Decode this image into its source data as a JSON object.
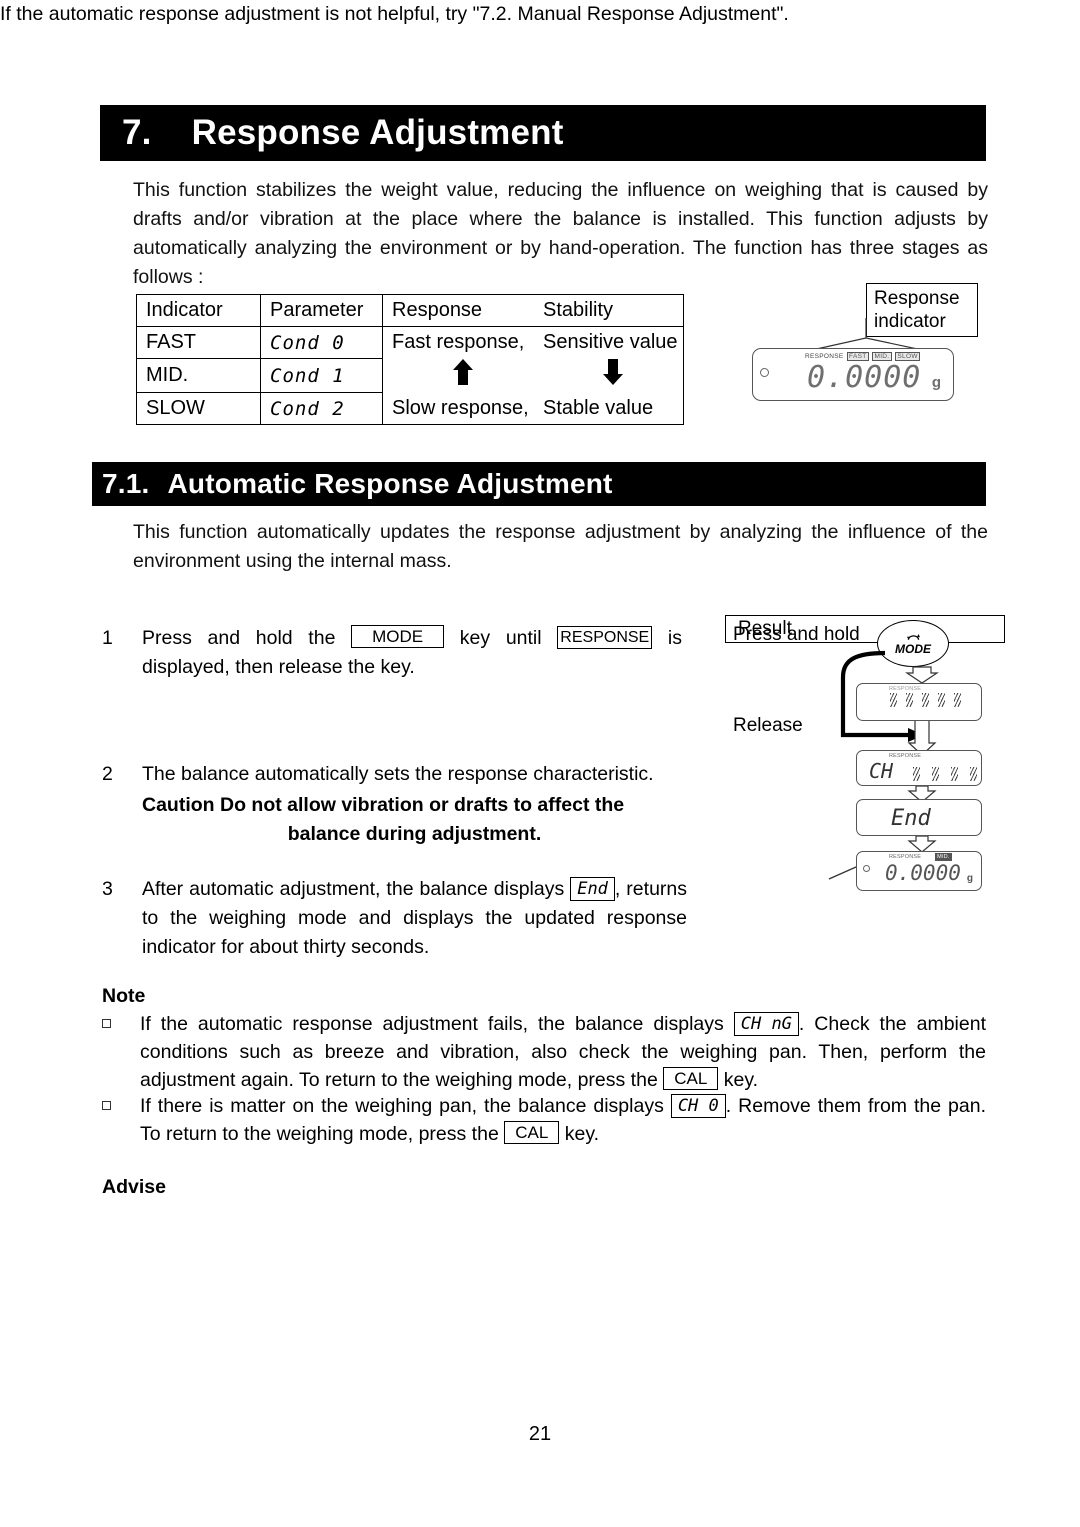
{
  "page": {
    "number": "21"
  },
  "heading": {
    "section_number": "7.",
    "section_title": "Response Adjustment",
    "sub_number": "7.1.",
    "sub_title": "Automatic Response Adjustment"
  },
  "intro": {
    "paragraph": "This function stabilizes the weight value, reducing the influence on weighing that is caused by drafts and/or vibration at the place where the balance is installed. This function adjusts by automatically analyzing the environment or by hand-operation. The function has three stages as follows :"
  },
  "table": {
    "headers": [
      "Indicator",
      "Parameter",
      "Response",
      "Stability"
    ],
    "rows": [
      {
        "indicator": "FAST",
        "parameter": "Cond 0",
        "response": "Fast response,",
        "stability": "Sensitive value"
      },
      {
        "indicator": "MID.",
        "parameter": "Cond 1",
        "response": "",
        "stability": ""
      },
      {
        "indicator": "SLOW",
        "parameter": "Cond 2",
        "response": "Slow response,",
        "stability": "Stable value"
      }
    ],
    "arrow_response": "up-arrow",
    "arrow_stability": "down-arrow"
  },
  "top_display": {
    "callout": "Response indicator",
    "annunciator_label": "RESPONSE",
    "indicators": [
      "FAST",
      "MID.",
      "SLOW"
    ],
    "digits": "0.0000",
    "unit": "g"
  },
  "auto_section": {
    "paragraph": "This function automatically updates the response adjustment by analyzing the influence of the environment using the internal mass."
  },
  "steps": [
    {
      "number": "1",
      "text_before": "Press and hold the",
      "key1": "MODE",
      "text_mid": "key until",
      "key2": "RESPONSE",
      "text_after": "is displayed, then release the key."
    },
    {
      "number": "2",
      "text": "The balance automatically sets the response characteristic.",
      "caution_lead": "Caution",
      "caution_line1": "Do not allow vibration or drafts to affect the",
      "caution_line2": "balance during adjustment."
    },
    {
      "number": "3",
      "text_before": "After automatic adjustment, the balance displays",
      "display": "End",
      "text_after": ", returns to the weighing mode and displays the updated response indicator for about thirty seconds."
    }
  ],
  "flow": {
    "press_hold_label": "Press and hold",
    "release_label": "Release",
    "result_label": "Result",
    "mode_key_label": "MODE",
    "mode_key_icon": "circular-arrow-icon",
    "display1_annunciator": "RESPONSE",
    "display2_annunciator": "RESPONSE",
    "display2_text": "CH",
    "display3_text": "End",
    "display4_annunciator": "RESPONSE",
    "display4_indicator": "MID.",
    "display4_digits": "0.0000",
    "display4_unit": "g"
  },
  "note": {
    "heading": "Note",
    "items": [
      {
        "text_before": "If the automatic response adjustment fails, the balance displays",
        "display": "CH nG",
        "text_mid": ". Check the ambient conditions such as breeze and vibration, also check the weighing pan. Then, perform the adjustment again. To return to the weighing mode, press the",
        "key": "CAL",
        "text_after": "key."
      },
      {
        "text_before": "If there is matter on the weighing pan, the balance displays",
        "display": "CH 0",
        "text_mid": ". Remove them from the pan. To return to the weighing mode, press the",
        "key": "CAL",
        "text_after": "key."
      }
    ]
  },
  "advise": {
    "heading": "Advise",
    "text": "If the automatic response adjustment is not helpful, try \"7.2. Manual Response Adjustment\"."
  }
}
